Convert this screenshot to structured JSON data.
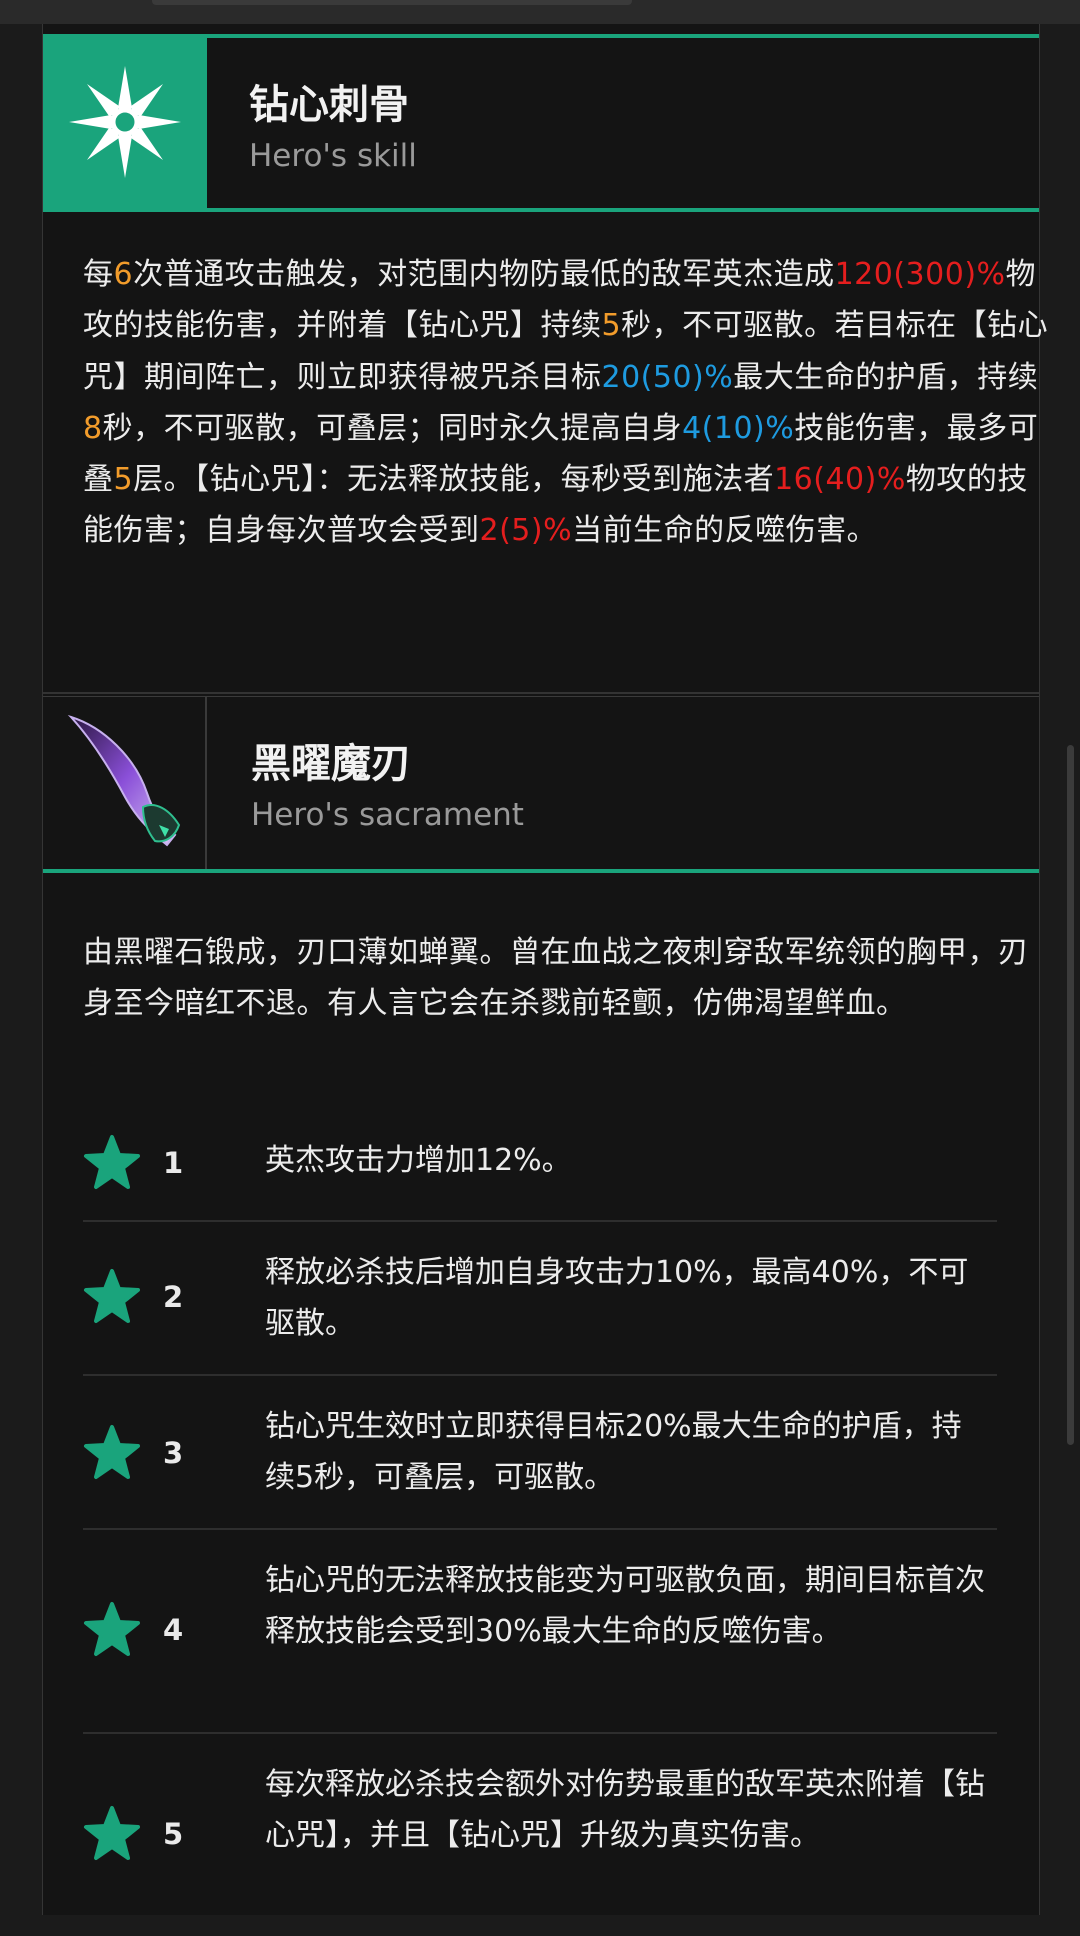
{
  "skill": {
    "title": "钻心刺骨",
    "subtitle": "Hero's skill",
    "description": [
      {
        "t": "每"
      },
      {
        "t": "6",
        "c": "o"
      },
      {
        "t": "次普通攻击触发，对范围内物防最低的敌军英杰造成"
      },
      {
        "t": "120(300)%",
        "c": "r"
      },
      {
        "t": "物攻的技能伤害，并附着【钻心咒】持续"
      },
      {
        "t": "5",
        "c": "o"
      },
      {
        "t": "秒，"
      },
      {
        "t": "不可驱散。若目标在【钻心咒】期间阵亡，则立即获得被咒杀目标"
      },
      {
        "t": "20(50)%",
        "c": "b"
      },
      {
        "t": "最大生命的护盾，持续"
      },
      {
        "t": "8",
        "c": "o"
      },
      {
        "t": "秒，不可驱散，可叠层；同时永久提高自身"
      },
      {
        "t": "4(10)%",
        "c": "b"
      },
      {
        "t": "技能伤害，最多可叠"
      },
      {
        "t": "5",
        "c": "o"
      },
      {
        "t": "层。【钻心咒】：无法释放技能，每秒受到施法者"
      },
      {
        "t": "16(40)%",
        "c": "r"
      },
      {
        "t": "物攻的技能伤害；自身每次普攻会受到"
      },
      {
        "t": "2(5)%",
        "c": "r"
      },
      {
        "t": "当前生命的反噬伤害。"
      }
    ]
  },
  "sacrament": {
    "title": "黑曜魔刃",
    "subtitle": "Hero's sacrament",
    "description": "由黑曜石锻成，刃口薄如蝉翼。曾在血战之夜刺穿敌军统领的胸甲，刃身至今暗红不退。有人言它会在杀戮前轻颤，仿佛渴望鲜血。"
  },
  "stars": [
    {
      "level": "1",
      "text": "英杰攻击力增加12%。"
    },
    {
      "level": "2",
      "text": "释放必杀技后增加自身攻击力10%，最高40%，不可驱散。"
    },
    {
      "level": "3",
      "text": "钻心咒生效时立即获得目标20%最大生命的护盾，持续5秒，可叠层，可驱散。"
    },
    {
      "level": "4",
      "text": "钻心咒的无法释放技能变为可驱散负面，期间目标首次释放技能会受到30%最大生命的反噬伤害。"
    },
    {
      "level": "5",
      "text": "每次释放必杀技会额外对伤势最重的敌军英杰附着【钻心咒】，并且【钻心咒】升级为真实伤害。"
    }
  ],
  "colors": {
    "accent": "#1aa47c",
    "orange": "#f29c2b",
    "red": "#e51e1e",
    "blue": "#1e9be0"
  },
  "icons": {
    "skill": "shuriken-icon",
    "sacrament": "dagger-icon",
    "star": "star-icon"
  }
}
